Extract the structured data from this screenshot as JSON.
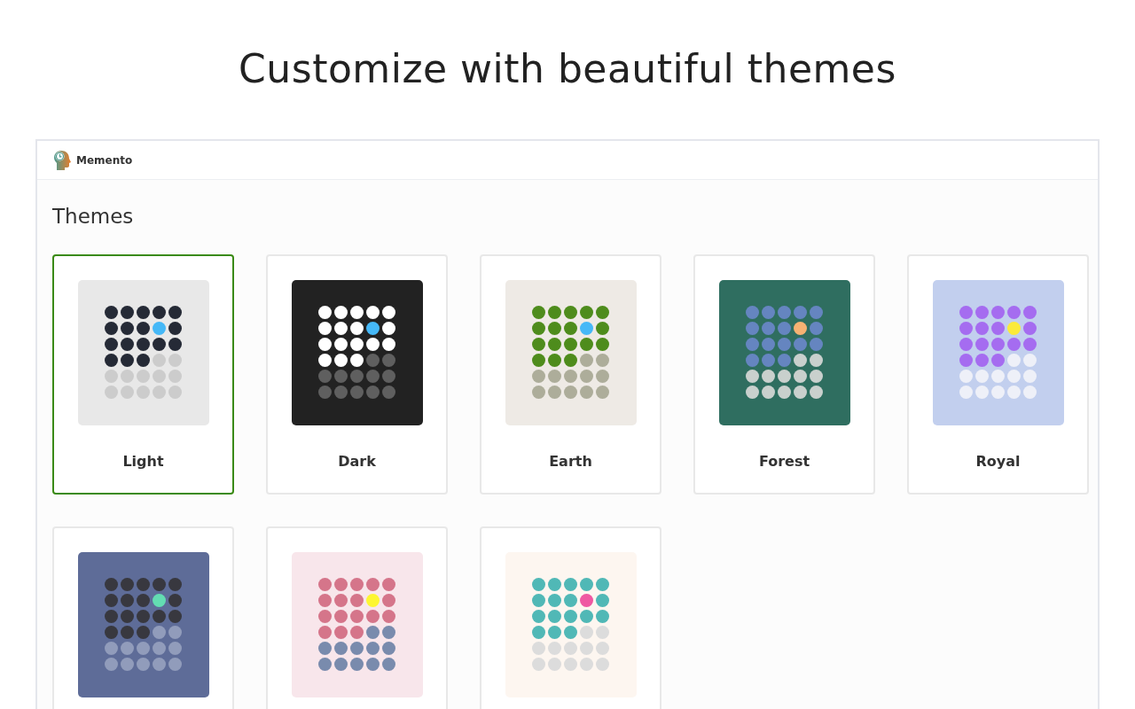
{
  "headline": "Customize with beautiful themes",
  "app": {
    "name": "Memento"
  },
  "section_title": "Themes",
  "themes": [
    {
      "name": "Light",
      "selected": true,
      "palette": [
        {
          "color": "#e8e8e8"
        },
        {
          "color": "#252a36"
        },
        {
          "color": "#45b8f7"
        },
        {
          "color": "#cccccc"
        }
      ]
    },
    {
      "name": "Dark",
      "selected": false,
      "palette": [
        {
          "color": "#222222"
        },
        {
          "color": "#ffffff"
        },
        {
          "color": "#45b8f7"
        },
        {
          "color": "#5f5f5f"
        }
      ]
    },
    {
      "name": "Earth",
      "selected": false,
      "palette": [
        {
          "color": "#eeeae5"
        },
        {
          "color": "#4e8c1c"
        },
        {
          "color": "#45b8f7"
        },
        {
          "color": "#adad9a"
        }
      ]
    },
    {
      "name": "Forest",
      "selected": false,
      "palette": [
        {
          "color": "#2f6e60"
        },
        {
          "color": "#6585c0"
        },
        {
          "color": "#f6b273"
        },
        {
          "color": "#c9d0cd"
        }
      ]
    },
    {
      "name": "Royal",
      "selected": false,
      "palette": [
        {
          "color": "#c2cfee"
        },
        {
          "color": "#a56cf0"
        },
        {
          "color": "#fbea3a"
        },
        {
          "color": "#eef0f8"
        }
      ]
    },
    {
      "selected": false,
      "palette": [
        {
          "color": "#5e6c98"
        },
        {
          "color": "#38383f"
        },
        {
          "color": "#63dcb2"
        },
        {
          "color": "#919cbb"
        }
      ]
    },
    {
      "selected": false,
      "palette": [
        {
          "color": "#f8e6eb"
        },
        {
          "color": "#d5758a"
        },
        {
          "color": "#fdf632"
        },
        {
          "color": "#798bad"
        }
      ]
    },
    {
      "selected": false,
      "palette": [
        {
          "color": "#fdf6f0"
        },
        {
          "color": "#50b8b6"
        },
        {
          "color": "#ef58a2"
        },
        {
          "color": "#dcdcdc"
        }
      ]
    }
  ]
}
